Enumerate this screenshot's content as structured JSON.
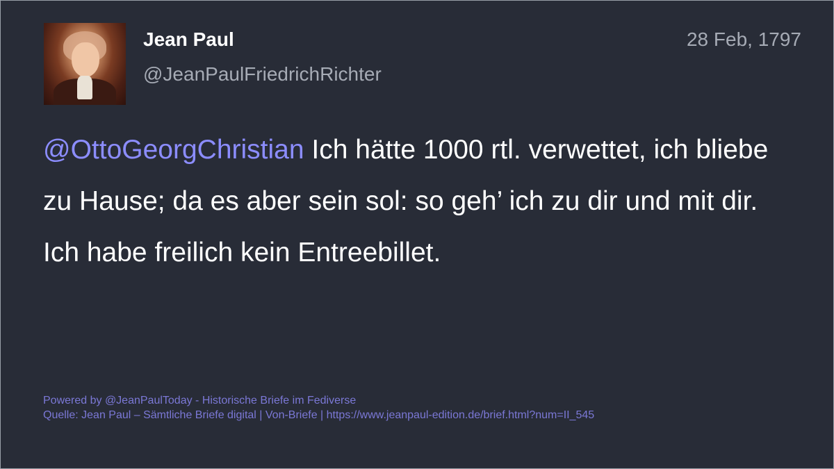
{
  "author": {
    "name": "Jean Paul",
    "handle": "@JeanPaulFriedrichRichter"
  },
  "post": {
    "date": "28 Feb, 1797",
    "mention": "@OttoGeorgChristian",
    "body": " Ich hätte 1000 rtl. verwettet, ich bliebe zu Hause; da es aber sein sol: so geh’ ich zu dir und mit dir. Ich habe freilich kein Entreebillet."
  },
  "footer": {
    "powered_by": "Powered by @JeanPaulToday - Historische Briefe im Fediverse",
    "source": "Quelle: Jean Paul – Sämtliche Briefe digital | Von-Briefe | https://www.jeanpaul-edition.de/brief.html?num=II_545"
  },
  "colors": {
    "background": "#282c37",
    "text": "#ffffff",
    "muted": "#a6abb5",
    "mention": "#8c8dff",
    "footer": "#7b78d6"
  },
  "icons": {
    "avatar": "portrait-avatar"
  }
}
